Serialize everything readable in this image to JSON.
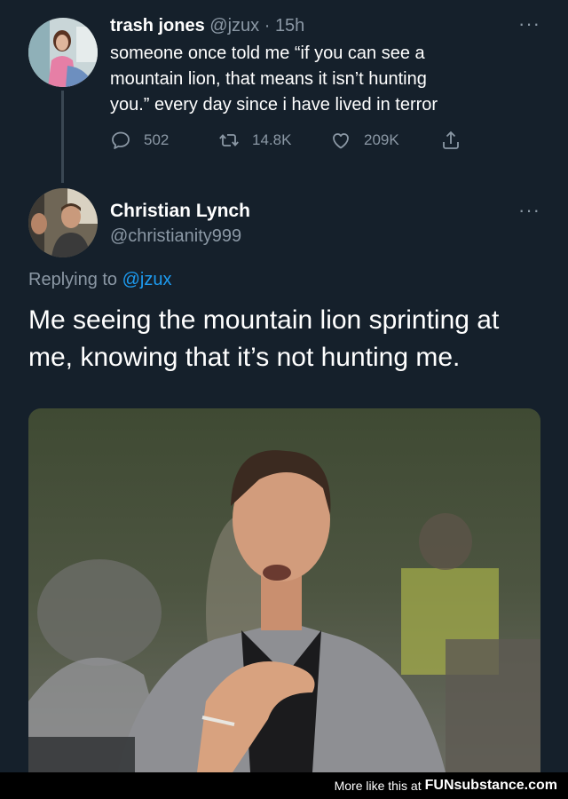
{
  "tweet1": {
    "name": "trash jones",
    "handle": "@jzux",
    "separator": "·",
    "time": "15h",
    "line1": "someone once told me “if you can see a",
    "line2": "mountain lion, that means it isn’t hunting",
    "line3": "you.” every day since i have lived in terror",
    "more": "···",
    "actions": {
      "replies": "502",
      "retweets": "14.8K",
      "likes": "209K"
    }
  },
  "tweet2": {
    "name": "Christian Lynch",
    "handle": "@christianity999",
    "more": "···",
    "replying_prefix": "Replying to",
    "replying_to": "@jzux",
    "line1": "Me seeing the mountain lion sprinting at",
    "line2": "me, knowing that it’s not hunting me."
  },
  "footer": {
    "text": "More like this at",
    "brand": "FUNsubstance.com"
  },
  "colors": {
    "background": "#15202b",
    "muted": "#8b98a5",
    "link": "#1d9bf0"
  },
  "icons": [
    "reply-icon",
    "retweet-icon",
    "like-icon",
    "share-icon",
    "more-icon"
  ]
}
